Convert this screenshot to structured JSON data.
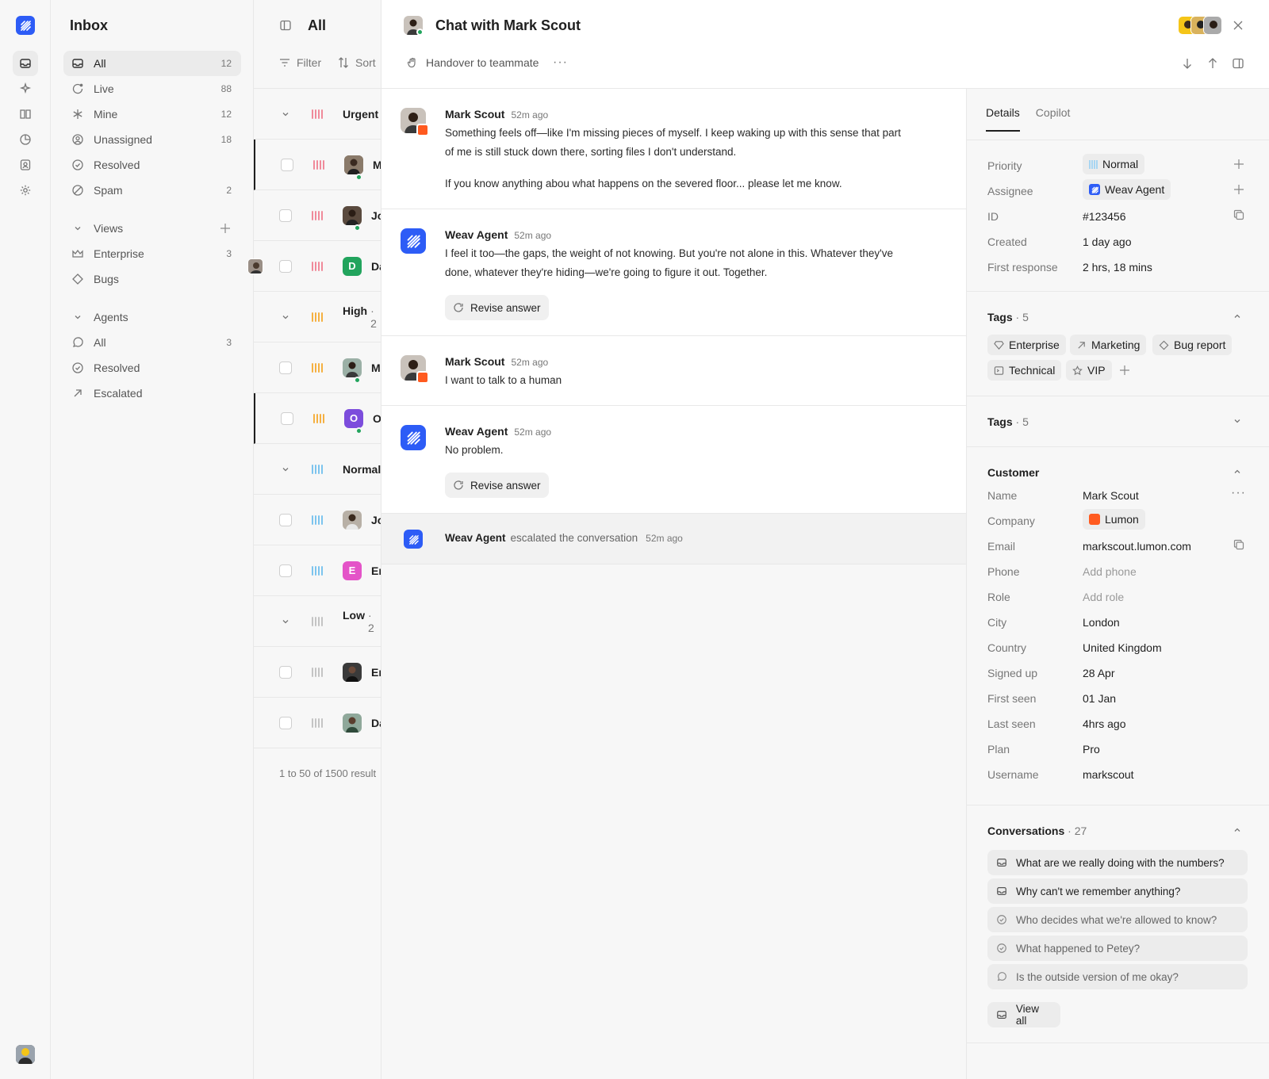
{
  "sidebar": {
    "title": "Inbox",
    "items": [
      {
        "label": "All",
        "count": "12"
      },
      {
        "label": "Live",
        "count": "88"
      },
      {
        "label": "Mine",
        "count": "12"
      },
      {
        "label": "Unassigned",
        "count": "18"
      },
      {
        "label": "Resolved",
        "count": ""
      },
      {
        "label": "Spam",
        "count": "2"
      }
    ],
    "views_header": "Views",
    "views": [
      {
        "label": "Enterprise",
        "count": "3"
      },
      {
        "label": "Bugs",
        "count": ""
      }
    ],
    "agents_header": "Agents",
    "agents": [
      {
        "label": "All",
        "count": "3"
      },
      {
        "label": "Resolved",
        "count": ""
      },
      {
        "label": "Escalated",
        "count": ""
      }
    ]
  },
  "list": {
    "title": "All",
    "filter_label": "Filter",
    "sort_label": "Sort",
    "groups": [
      {
        "label": "Urgent",
        "count": ""
      },
      {
        "label": "High",
        "count": "· 2"
      },
      {
        "label": "Normal",
        "count": ""
      },
      {
        "label": "Low",
        "count": "· 2"
      }
    ],
    "rows": [
      {
        "name": "M"
      },
      {
        "name": "Jo"
      },
      {
        "name": "Da",
        "initial": "D"
      },
      {
        "name": "M"
      },
      {
        "name": "Ol",
        "initial": "O"
      },
      {
        "name": "Jo"
      },
      {
        "name": "Er",
        "initial": "E"
      },
      {
        "name": "Er"
      },
      {
        "name": "Da"
      }
    ],
    "footer": "1 to 50 of 1500 result"
  },
  "chat": {
    "title": "Chat with Mark Scout",
    "handover_label": "Handover to teammate",
    "messages": [
      {
        "author": "Mark Scout",
        "time": "52m ago",
        "paragraphs": [
          "Something feels off—like I'm missing pieces of myself. I keep waking up with this sense that part of me is still stuck down there, sorting files I don't understand.",
          "If you know anything abou what happens on the severed floor... please let me know."
        ]
      },
      {
        "author": "Weav Agent",
        "time": "52m ago",
        "paragraphs": [
          "I feel it too—the gaps, the weight of not knowing. But you're not alone in this. Whatever they've done, whatever they're hiding—we're going to figure it out. Together."
        ],
        "action": "Revise answer"
      },
      {
        "author": "Mark Scout",
        "time": "52m ago",
        "paragraphs": [
          "I want to talk to a human"
        ]
      },
      {
        "author": "Weav Agent",
        "time": "52m ago",
        "paragraphs": [
          "No problem."
        ],
        "action": "Revise answer"
      }
    ],
    "event": {
      "author": "Weav Agent",
      "text": "escalated the conversation",
      "time": "52m ago"
    }
  },
  "details": {
    "tabs": [
      "Details",
      "Copilot"
    ],
    "props": [
      {
        "label": "Priority",
        "value": "Normal"
      },
      {
        "label": "Assignee",
        "value": "Weav Agent"
      },
      {
        "label": "ID",
        "value": "#123456"
      },
      {
        "label": "Created",
        "value": "1 day ago"
      },
      {
        "label": "First response",
        "value": "2 hrs, 18 mins"
      }
    ],
    "tags_title": "Tags",
    "tags_count": "· 5",
    "tags": [
      "Enterprise",
      "Marketing",
      "Bug report",
      "Technical",
      "VIP"
    ],
    "tags2_title": "Tags",
    "tags2_count": "· 5",
    "customer_title": "Customer",
    "customer": [
      {
        "label": "Name",
        "value": "Mark Scout"
      },
      {
        "label": "Company",
        "value": "Lumon"
      },
      {
        "label": "Email",
        "value": "markscout.lumon.com"
      },
      {
        "label": "Phone",
        "value": "Add phone"
      },
      {
        "label": "Role",
        "value": "Add role"
      },
      {
        "label": "City",
        "value": "London"
      },
      {
        "label": "Country",
        "value": "United Kingdom"
      },
      {
        "label": "Signed up",
        "value": "28 Apr"
      },
      {
        "label": "First seen",
        "value": "01 Jan"
      },
      {
        "label": "Last seen",
        "value": "4hrs ago"
      },
      {
        "label": "Plan",
        "value": "Pro"
      },
      {
        "label": "Username",
        "value": "markscout"
      }
    ],
    "conversations_title": "Conversations",
    "conversations_count": "· 27",
    "conversations": [
      "What are we really doing with the numbers?",
      "Why can't we remember anything?",
      "Who decides what we're allowed to know?",
      "What happened to Petey?",
      "Is the outside version of me okay?"
    ],
    "view_all": "View all"
  },
  "colors": {
    "brand": "#2d5cf6",
    "urgent": "#f08a9a",
    "high": "#f5b041",
    "normal": "#7cc4ee",
    "low": "#c4c4c4",
    "online": "#22a45d",
    "lumon": "#ff5a1f"
  }
}
